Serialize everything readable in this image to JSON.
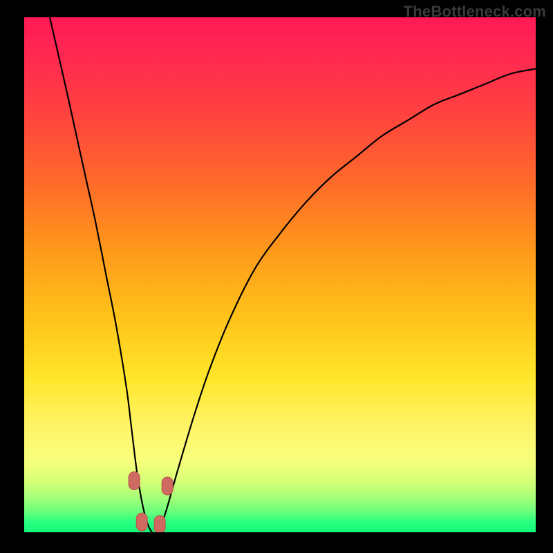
{
  "watermark": "TheBottleneck.com",
  "chart_data": {
    "type": "line",
    "title": "",
    "xlabel": "",
    "ylabel": "",
    "xlim": [
      0,
      100
    ],
    "ylim": [
      0,
      100
    ],
    "series": [
      {
        "name": "bottleneck-curve",
        "x": [
          5,
          8,
          10,
          12,
          14,
          16,
          18,
          20,
          21,
          22,
          23,
          24,
          25,
          26,
          27,
          28,
          30,
          33,
          36,
          40,
          45,
          50,
          55,
          60,
          65,
          70,
          75,
          80,
          85,
          90,
          95,
          100
        ],
        "y": [
          100,
          87,
          78,
          69,
          60,
          50,
          40,
          28,
          20,
          12,
          6,
          2,
          0,
          0,
          2,
          5,
          12,
          22,
          31,
          41,
          51,
          58,
          64,
          69,
          73,
          77,
          80,
          83,
          85,
          87,
          89,
          90
        ]
      }
    ],
    "markers": [
      {
        "name": "marker-a",
        "x": 21.5,
        "y": 10
      },
      {
        "name": "marker-b",
        "x": 23.0,
        "y": 2
      },
      {
        "name": "marker-c",
        "x": 26.5,
        "y": 1.5
      },
      {
        "name": "marker-d",
        "x": 28.0,
        "y": 9
      }
    ],
    "colors": {
      "curve": "#000000",
      "marker_fill": "#cf6a60",
      "marker_stroke": "#b9544d"
    }
  }
}
